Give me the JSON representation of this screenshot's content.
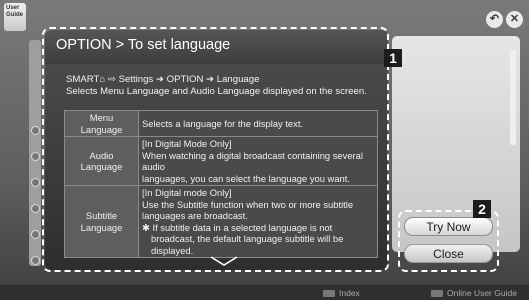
{
  "app": {
    "logo_line1": "User",
    "logo_line2": "Guide"
  },
  "dialog": {
    "title": "OPTION > To set language",
    "path": "SMART⌂ ⇨ Settings ➔ OPTION ➔ Language",
    "description": "Selects Menu Language and Audio Language displayed on the screen.",
    "rows": [
      {
        "key": "Menu Language",
        "lines": [
          "Selects a language for the display text."
        ]
      },
      {
        "key": "Audio Language",
        "lines": [
          "[In Digital Mode Only]",
          "When watching a digital broadcast containing several audio",
          "languages, you can select the language you want."
        ]
      },
      {
        "key": "Subtitle Language",
        "lines": [
          "[In Digital mode Only]",
          "Use the Subtitle function when two or more subtitle",
          "languages are broadcast."
        ],
        "note": "✱ If subtitle data in a selected language is not broadcast, the default language subtitle will be displayed."
      }
    ]
  },
  "badges": {
    "one": "1",
    "two": "2"
  },
  "buttons": {
    "try_now": "Try Now",
    "close": "Close"
  },
  "top_icons": {
    "back": "↶",
    "exit": "✕"
  },
  "footer": {
    "index": "Index",
    "online_guide": "Online User Guide"
  },
  "icons": {
    "back": "back-icon",
    "exit": "close-icon",
    "scroll_down": "chevron-down-icon"
  }
}
